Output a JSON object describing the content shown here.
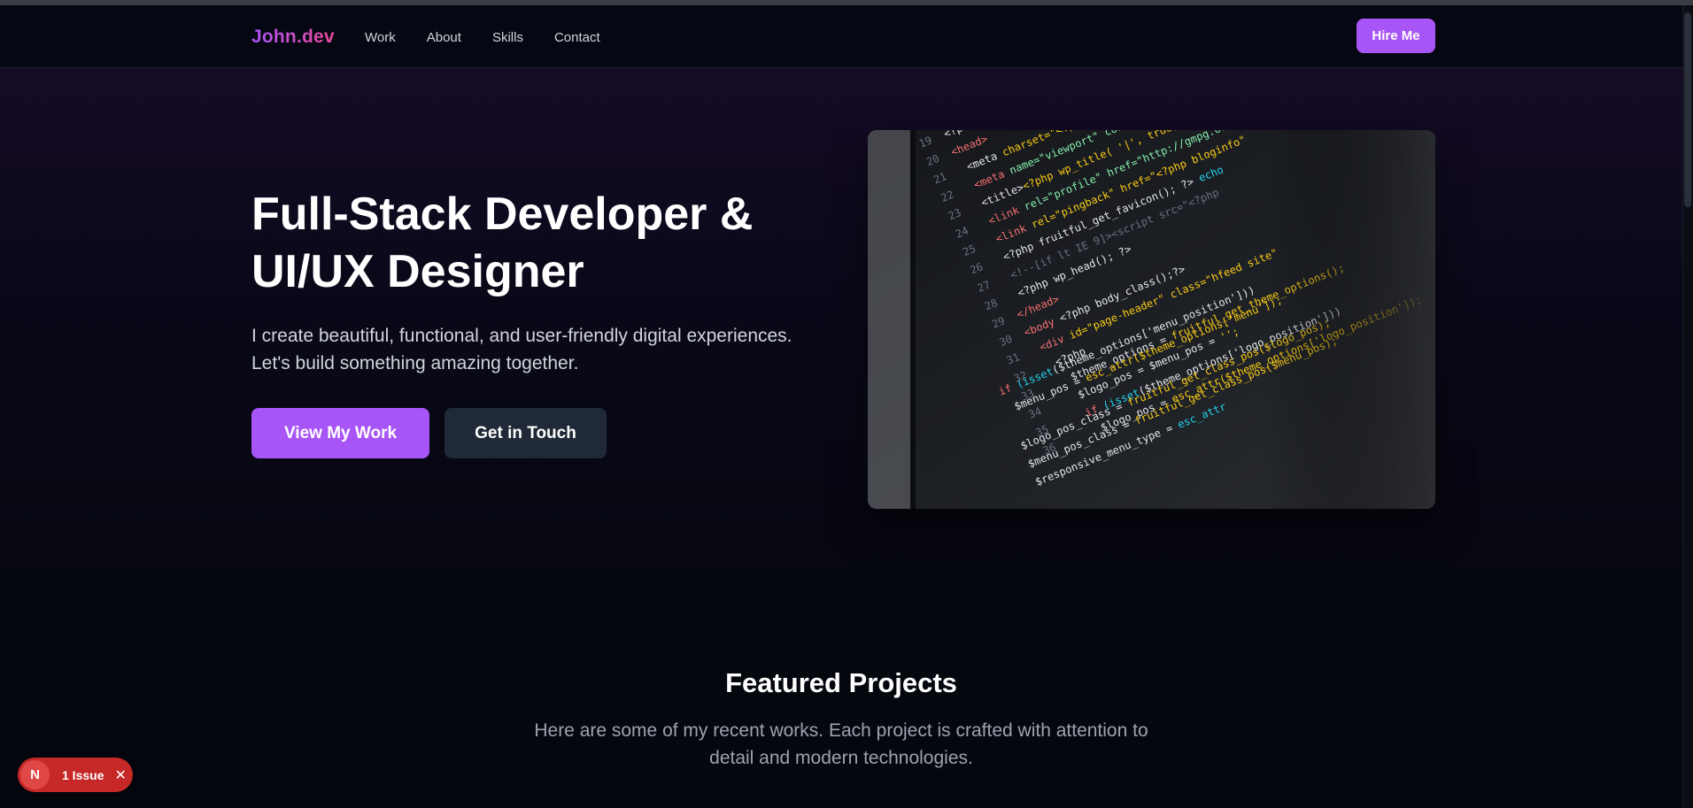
{
  "nav": {
    "logo": "John.dev",
    "links": [
      "Work",
      "About",
      "Skills",
      "Contact"
    ],
    "hire_label": "Hire Me"
  },
  "hero": {
    "title_line1": "Full-Stack Developer &",
    "title_line2": "UI/UX Designer",
    "subtitle_line1": "I create beautiful, functional, and user-friendly digital experiences.",
    "subtitle_line2": "Let's build something amazing together.",
    "primary_cta": "View My Work",
    "secondary_cta": "Get in Touch"
  },
  "projects": {
    "title": "Featured Projects",
    "subtitle_line1": "Here are some of my recent works. Each project is crafted with attention to",
    "subtitle_line2": "detail and modern technologies."
  },
  "dev_overlay": {
    "icon_letter": "N",
    "issues_label": "1 Issue",
    "close_glyph": "✕"
  },
  "colors": {
    "accent": "#a855f7",
    "accent_pink": "#ec4899",
    "background": "#05070f",
    "secondary_button": "#1f2937",
    "issue_badge": "#c62828"
  }
}
